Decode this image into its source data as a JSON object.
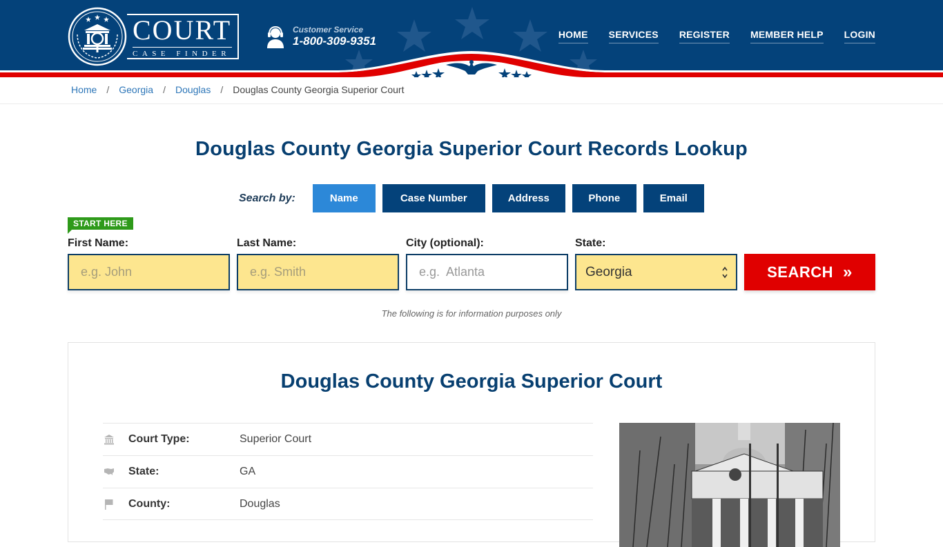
{
  "header": {
    "logo": {
      "title": "COURT",
      "subtitle": "CASE FINDER"
    },
    "customer_service": {
      "label": "Customer Service",
      "phone": "1-800-309-9351"
    },
    "nav": [
      "HOME",
      "SERVICES",
      "REGISTER",
      "MEMBER HELP",
      "LOGIN"
    ],
    "colors": {
      "navy": "#04427a",
      "red": "#e00000"
    }
  },
  "breadcrumb": {
    "items": [
      "Home",
      "Georgia",
      "Douglas"
    ],
    "current": "Douglas County Georgia Superior Court",
    "separator": "/"
  },
  "page_title": "Douglas County Georgia Superior Court Records Lookup",
  "search": {
    "search_by_label": "Search by:",
    "tabs": [
      {
        "label": "Name",
        "active": true
      },
      {
        "label": "Case Number",
        "active": false
      },
      {
        "label": "Address",
        "active": false
      },
      {
        "label": "Phone",
        "active": false
      },
      {
        "label": "Email",
        "active": false
      }
    ],
    "start_badge": "START HERE",
    "fields": {
      "first_name": {
        "label": "First Name:",
        "placeholder": "e.g. John",
        "value": ""
      },
      "last_name": {
        "label": "Last Name:",
        "placeholder": "e.g. Smith",
        "value": ""
      },
      "city": {
        "label": "City (optional):",
        "placeholder": "e.g.  Atlanta",
        "value": ""
      },
      "state": {
        "label": "State:",
        "value": "Georgia"
      }
    },
    "submit_label": "SEARCH",
    "submit_icon": "»",
    "disclaimer": "The following is for information purposes only"
  },
  "court_card": {
    "title": "Douglas County Georgia Superior Court",
    "rows": [
      {
        "icon": "courthouse-icon",
        "label": "Court Type:",
        "value": "Superior Court"
      },
      {
        "icon": "us-map-icon",
        "label": "State:",
        "value": "GA"
      },
      {
        "icon": "flag-icon",
        "label": "County:",
        "value": "Douglas"
      }
    ],
    "photo_alt": "Douglas County courthouse photo"
  }
}
